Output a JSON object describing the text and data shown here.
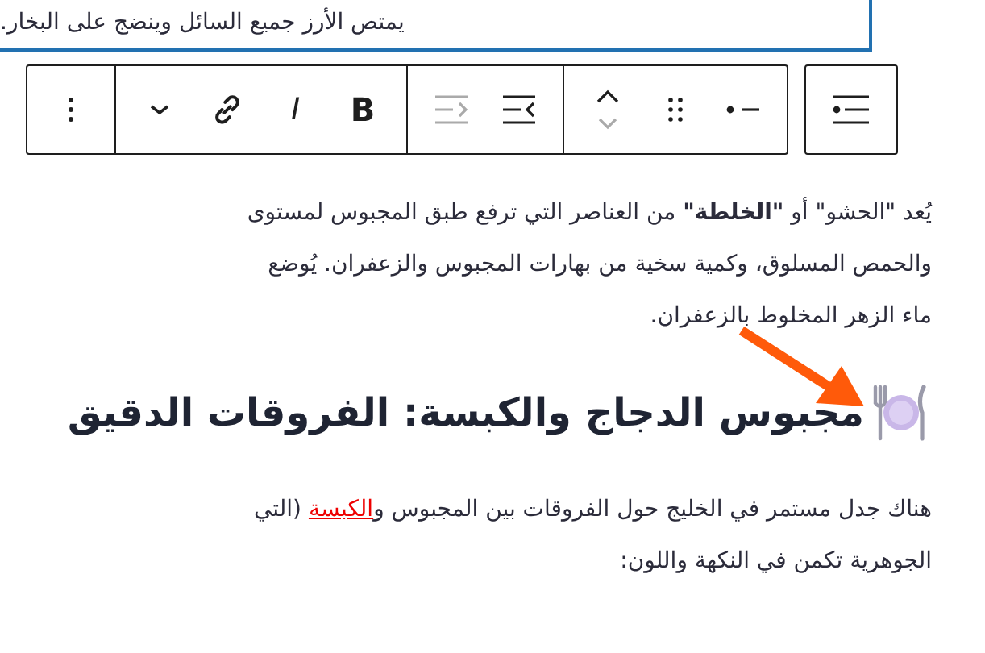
{
  "selected_block": {
    "text": "يمتص الأرز جميع السائل وينضج على البخار."
  },
  "toolbar": {
    "list_button": {
      "kind": "list"
    },
    "groups": [
      [
        {
          "kind": "list-style"
        },
        {
          "kind": "drag"
        },
        {
          "kind": "move"
        }
      ],
      [
        {
          "kind": "indent",
          "disabled": false
        },
        {
          "kind": "outdent",
          "disabled": true
        }
      ],
      [
        {
          "kind": "bold",
          "label": "B"
        },
        {
          "kind": "italic",
          "label": "I"
        },
        {
          "kind": "link"
        },
        {
          "kind": "chevron"
        }
      ],
      [
        {
          "kind": "more"
        }
      ]
    ]
  },
  "paragraph_1": {
    "lines": [
      "يُعد \"الحشو\" أو **\"الخلطة\"** من العناصر التي ترفع طبق المجبوس لمستوى",
      "والحمص المسلوق، وكمية سخية من بهارات المجبوس والزعفران. يُوضع",
      "ماء الزهر المخلوط بالزعفران."
    ]
  },
  "heading": {
    "text": "مجبوس الدجاج والكبسة: الفروقات الدقيق"
  },
  "paragraph_2": {
    "line_1_before": "هناك جدل مستمر في الخليج حول الفروقات بين المجبوس و",
    "line_1_link": "الكبسة",
    "line_1_after": " (التي",
    "line_2": "الجوهرية تكمن في النكهة واللون:"
  }
}
